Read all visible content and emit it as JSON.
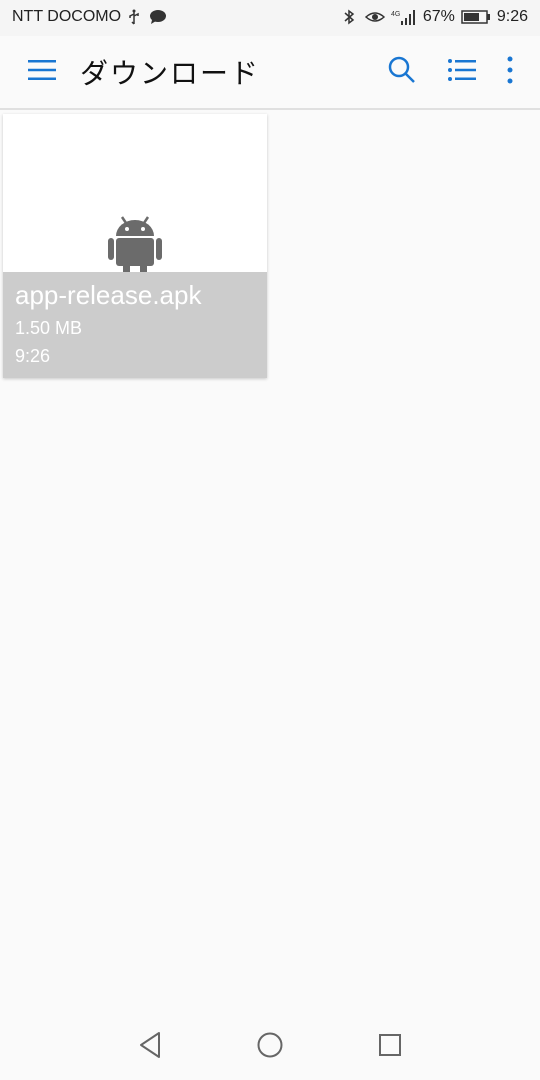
{
  "status_bar": {
    "carrier": "NTT DOCOMO",
    "battery_percent": "67%",
    "time": "9:26",
    "icons": [
      "usb-icon",
      "chat-icon",
      "bluetooth-icon",
      "eye-icon",
      "4g-signal-icon",
      "battery-icon"
    ]
  },
  "app_bar": {
    "title": "ダウンロード",
    "accent_color": "#1976d2",
    "icons": [
      "menu-icon",
      "search-icon",
      "list-view-icon",
      "more-vert-icon"
    ]
  },
  "files": [
    {
      "name": "app-release.apk",
      "size": "1.50 MB",
      "time": "9:26",
      "icon": "android-icon"
    }
  ],
  "nav_bar": {
    "icons": [
      "back-icon",
      "home-icon",
      "recents-icon"
    ]
  }
}
